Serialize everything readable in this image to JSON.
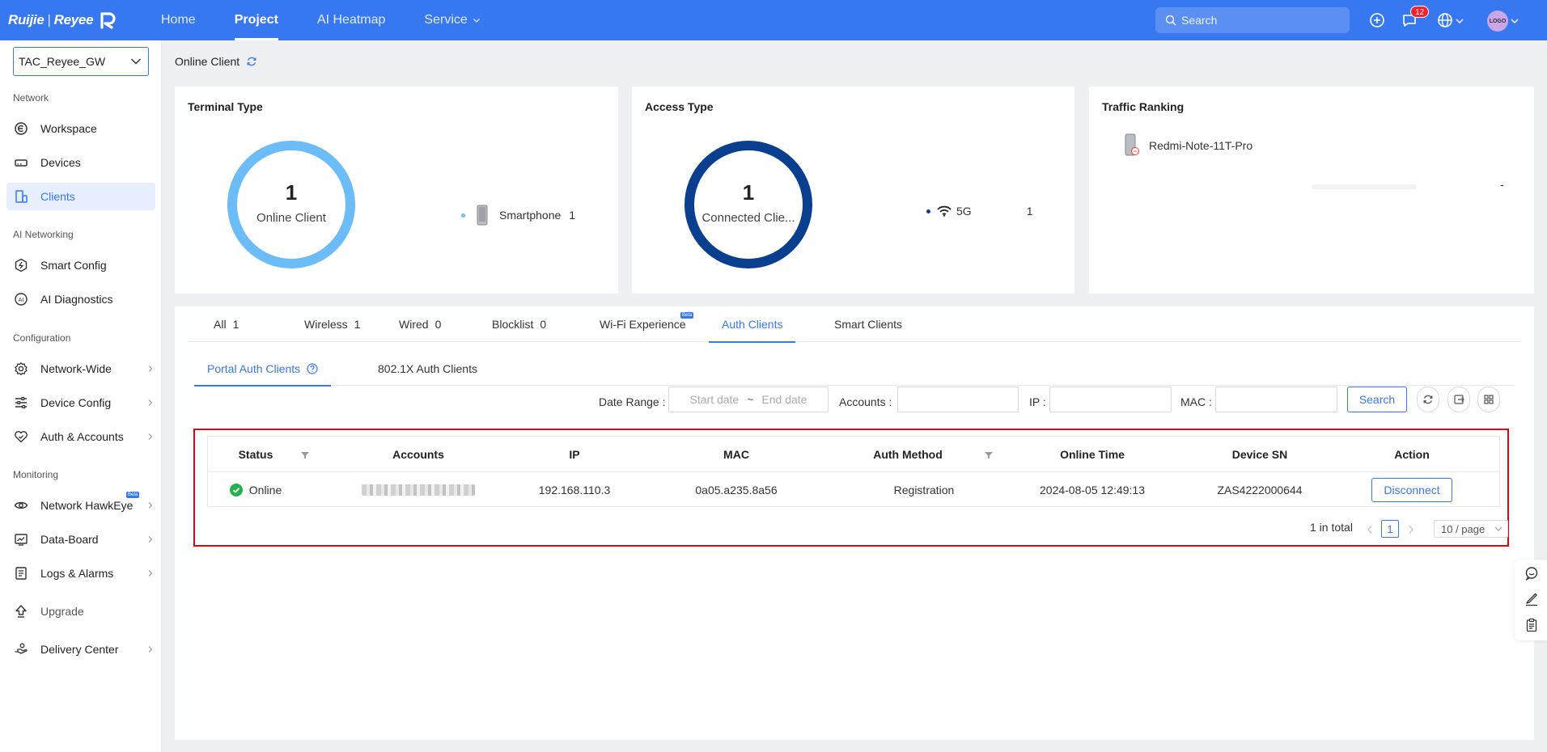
{
  "brand": {
    "name_left": "Ruijie",
    "name_right": "Reyee"
  },
  "topnav": {
    "items": [
      {
        "label": "Home"
      },
      {
        "label": "Project"
      },
      {
        "label": "AI Heatmap"
      },
      {
        "label": "Service"
      }
    ],
    "search_placeholder": "Search",
    "notification_count": "12",
    "avatar_text": "LOGO"
  },
  "sidebar": {
    "project": "TAC_Reyee_GW",
    "sections": {
      "network": "Network",
      "ai_networking": "AI Networking",
      "configuration": "Configuration",
      "monitoring": "Monitoring"
    },
    "items": {
      "workspace": "Workspace",
      "devices": "Devices",
      "clients": "Clients",
      "smart_config": "Smart Config",
      "ai_diagnostics": "AI Diagnostics",
      "network_wide": "Network-Wide",
      "device_config": "Device Config",
      "auth_accounts": "Auth & Accounts",
      "network_hawkeye": "Network HawkEye",
      "data_board": "Data-Board",
      "logs_alarms": "Logs & Alarms",
      "upgrade": "Upgrade",
      "delivery_center": "Delivery Center"
    },
    "beta_label": "Beta"
  },
  "page": {
    "title": "Online Client"
  },
  "terminal_type": {
    "title": "Terminal Type",
    "count": "1",
    "label": "Online Client",
    "legend_name": "Smartphone",
    "legend_value": "1"
  },
  "access_type": {
    "title": "Access Type",
    "count": "1",
    "label": "Connected Clie...",
    "legend_name": "5G",
    "legend_value": "1"
  },
  "traffic_ranking": {
    "title": "Traffic Ranking",
    "device": "Redmi-Note-11T-Pro",
    "value": "-"
  },
  "tabs": [
    {
      "label": "All",
      "count": "1"
    },
    {
      "label": "Wireless",
      "count": "1"
    },
    {
      "label": "Wired",
      "count": "0"
    },
    {
      "label": "Blocklist",
      "count": "0"
    },
    {
      "label": "Wi-Fi Experience",
      "count": ""
    },
    {
      "label": "Auth Clients",
      "count": ""
    },
    {
      "label": "Smart Clients",
      "count": ""
    }
  ],
  "subtabs": [
    {
      "label": "Portal Auth Clients"
    },
    {
      "label": "802.1X Auth Clients"
    }
  ],
  "filters": {
    "date_range_label": "Date Range",
    "start_placeholder": "Start date",
    "end_placeholder": "End date",
    "accounts_label": "Accounts",
    "ip_label": "IP",
    "mac_label": "MAC",
    "search_button": "Search"
  },
  "table": {
    "columns": [
      "Status",
      "Accounts",
      "IP",
      "MAC",
      "Auth Method",
      "Online Time",
      "Device SN",
      "Action"
    ],
    "rows": [
      {
        "status": "Online",
        "ip": "192.168.110.3",
        "mac": "0a05.a235.8a56",
        "auth_method": "Registration",
        "online_time": "2024-08-05 12:49:13",
        "device_sn": "ZAS4222000644",
        "action": "Disconnect"
      }
    ]
  },
  "pagination": {
    "total": "1 in total",
    "current": "1",
    "page_size": "10 / page"
  },
  "colors": {
    "primary": "#3777f0",
    "terminal_ring": "#6bbcf7",
    "access_ring": "#0a3f8f",
    "online_green": "#22b14c",
    "highlight_red": "#e60012"
  }
}
